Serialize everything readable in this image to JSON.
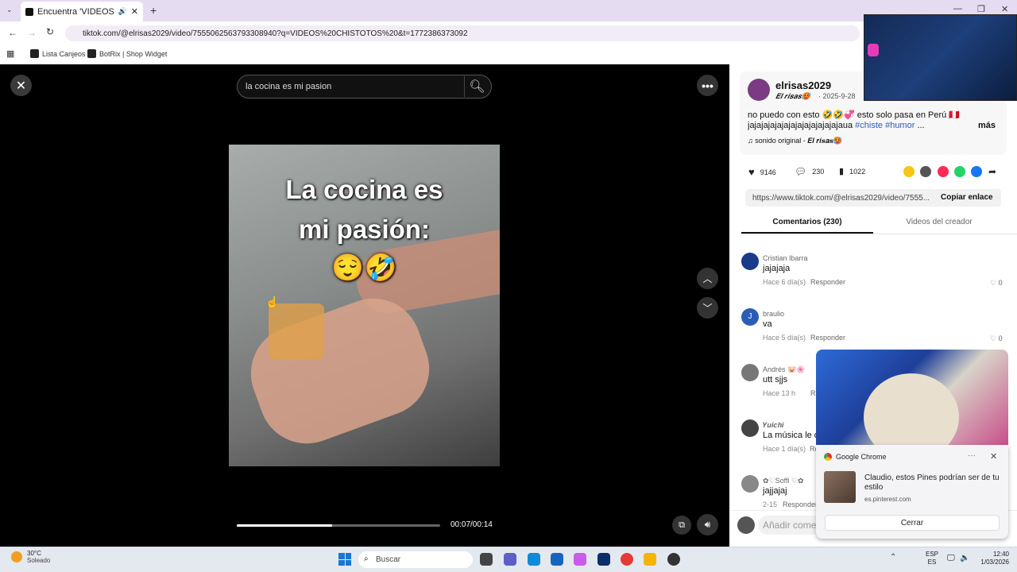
{
  "browser": {
    "tab_title": "Encuentra 'VIDEOS CHISTO",
    "url": "tiktok.com/@elrisas2029/video/7555062563793308940?q=VIDEOS%20CHISTOTOS%20&t=1772386373092",
    "bookmarks": [
      "Lista Canjeos",
      "BotRix | Shop Widget"
    ]
  },
  "player": {
    "search_value": "la cocina es mi pasion",
    "caption_line1": "La cocina es",
    "caption_line2": "mi pasión:",
    "caption_emoji": "😌🤣",
    "time": "00:07/00:14",
    "progress_fraction": 0.47
  },
  "post": {
    "username": "elrisas2029",
    "nickname": "𝑬𝒍 𝒓𝒊𝒔𝒂𝒔🥵",
    "date": "· 2025-9-28",
    "desc_line1": "no puedo con esto 🤣🤣💞 esto solo pasa en Perú 🇵🇪",
    "desc_line2_text": "jajajajajajajajajajajajajajaua ",
    "tag1": "#chiste",
    "tag2": "#humor",
    "ellipsis": "...",
    "more": "más",
    "sound": "sonido original - 𝑬𝒍 𝒓𝒊𝒔𝒂𝒔🥵",
    "likes": "9146",
    "comments": "230",
    "saves": "1022",
    "link": "https://www.tiktok.com/@elrisas2029/video/7555...",
    "copy_label": "Copiar enlace",
    "tab_comments": "Comentarios (230)",
    "tab_creator": "Videos del creador"
  },
  "comments": [
    {
      "name": "Cristian Ibarra",
      "text": "jajajaja",
      "meta": "Hace 6 día(s)",
      "reply": "Responder",
      "likes": "0",
      "color": "#1a3a8a"
    },
    {
      "name": "braulio",
      "text": "va",
      "meta": "Hace 5 día(s)",
      "reply": "Responder",
      "likes": "0",
      "color": "#2b5db8",
      "initial": "J"
    },
    {
      "name": "Andrés 🐷🌸",
      "text": "utt sjjs",
      "meta": "Hace 13 h",
      "reply": "Resp",
      "color": "#777"
    },
    {
      "name": "𝒀𝒖𝒊𝒄𝒉𝒊",
      "text": "La música le da",
      "meta": "Hace 1 día(s)",
      "reply": "Re",
      "color": "#444"
    },
    {
      "name": "✿♡Soffi ♡✿",
      "text": "jajjajaj",
      "meta": "2-15",
      "reply": "Responder",
      "color": "#888"
    }
  ],
  "add_comment": "Añadir come",
  "notification": {
    "app": "Google Chrome",
    "menu": "···",
    "text": "Claudio, estos Pines podrían ser de tu estilo",
    "source": "es.pinterest.com",
    "button": "Cerrar"
  },
  "taskbar": {
    "temp": "30°C",
    "condition": "Soleado",
    "search": "Buscar",
    "lang1": "ESP",
    "lang2": "ES",
    "time": "12:40",
    "date": "1/03/2026"
  }
}
